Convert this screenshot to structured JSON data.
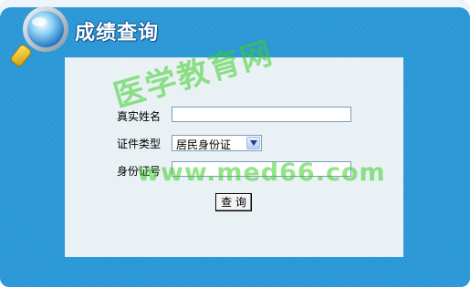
{
  "header": {
    "title": "成绩查询",
    "icon": "magnifier-icon"
  },
  "form": {
    "name_label": "真实姓名",
    "name_value": "",
    "id_type_label": "证件类型",
    "id_type_selected": "居民身份证",
    "id_number_label": "身份证号",
    "id_number_value": "",
    "submit_label": "查 询"
  },
  "watermark": {
    "cn_text": "医学教育网",
    "url_text": "www.med66.com"
  },
  "colors": {
    "panel_blue": "#2a97d6",
    "card_bg": "#e9f1f5",
    "watermark_green": "#3ccd28"
  }
}
